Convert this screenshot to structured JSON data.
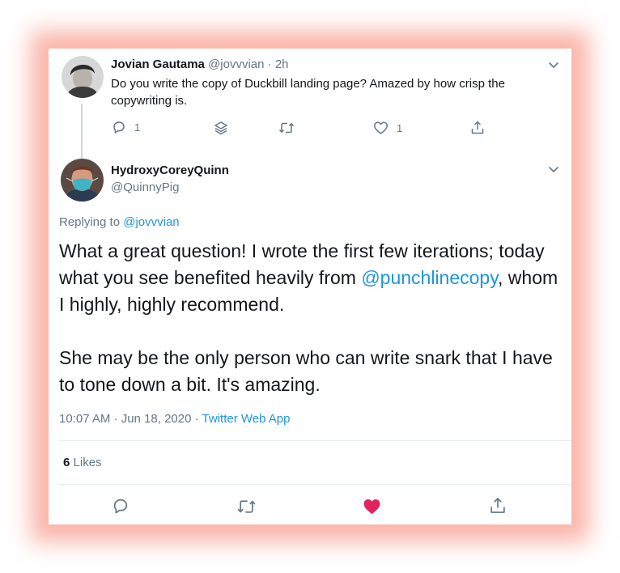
{
  "reply_tweet": {
    "author_name": "Jovian Gautama",
    "author_handle": "@jovvvian",
    "separator": "·",
    "time_ago": "2h",
    "text": "Do you write the copy of Duckbill landing page? Amazed by how crisp the copywriting is.",
    "reply_count": "1",
    "like_count": "1",
    "icons": [
      "reply-icon",
      "layers-icon",
      "retweet-icon",
      "heart-outline-icon",
      "share-icon"
    ]
  },
  "main_tweet": {
    "author_name": "HydroxyCoreyQuinn",
    "author_handle": "@QuinnyPig",
    "replying_label": "Replying to",
    "replying_handle": "@jovvvian",
    "text_part1": "What a great question! I wrote the first few iterations; today what you see benefited heavily from",
    "mention": "@punchlinecopy",
    "text_part2": ", whom I highly, highly recommend.",
    "text_para2": "She may be the only person who can write snark that I have to tone down a bit. It's amazing.",
    "timestamp": "10:07 AM · Jun 18, 2020",
    "dot": "·",
    "source": "Twitter Web App",
    "likes_count": "6",
    "likes_label": "Likes",
    "icons": [
      "reply-icon",
      "retweet-icon",
      "heart-filled-icon",
      "share-icon"
    ]
  },
  "colors": {
    "accent": "#1b95e0",
    "liked": "#e0245e",
    "muted": "#657786",
    "glow": "#f67864"
  }
}
